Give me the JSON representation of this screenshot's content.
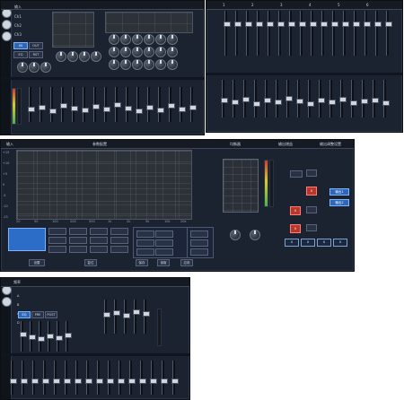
{
  "panel_1": {
    "title": "",
    "left_labels": [
      "输入",
      "Ch1",
      "Ch2",
      "Ch3"
    ],
    "buttons": [
      "IN",
      "OUT",
      "EQ",
      "RST"
    ]
  },
  "panel_2": {
    "top_labels": [
      "1",
      "2",
      "3",
      "4",
      "5",
      "6"
    ]
  },
  "panel_3": {
    "title": "参数配置",
    "right_title_1": "均衡器",
    "right_title_2": "输出增益",
    "right_title_3": "输出调整设置",
    "left_header": "输入",
    "x_ticks": [
      "20",
      "50",
      "100",
      "200",
      "500",
      "1k",
      "2k",
      "5k",
      "10k",
      "20k"
    ],
    "db_ticks": [
      "+15",
      "+10",
      "+5",
      "0",
      "-5",
      "-10",
      "-15"
    ],
    "buttons": [
      "设置",
      "复位",
      "保存",
      "读取",
      "应用"
    ],
    "small_values": [
      "0",
      "0",
      "0",
      "0"
    ],
    "blue_buttons": [
      "输出1",
      "输出2"
    ],
    "red_values": [
      "0",
      "0",
      "0"
    ]
  },
  "panel_4": {
    "title": "频率",
    "row_labels": [
      "A",
      "B",
      "C",
      "D"
    ],
    "buttons": [
      "EQ",
      "PRE",
      "POST"
    ]
  }
}
